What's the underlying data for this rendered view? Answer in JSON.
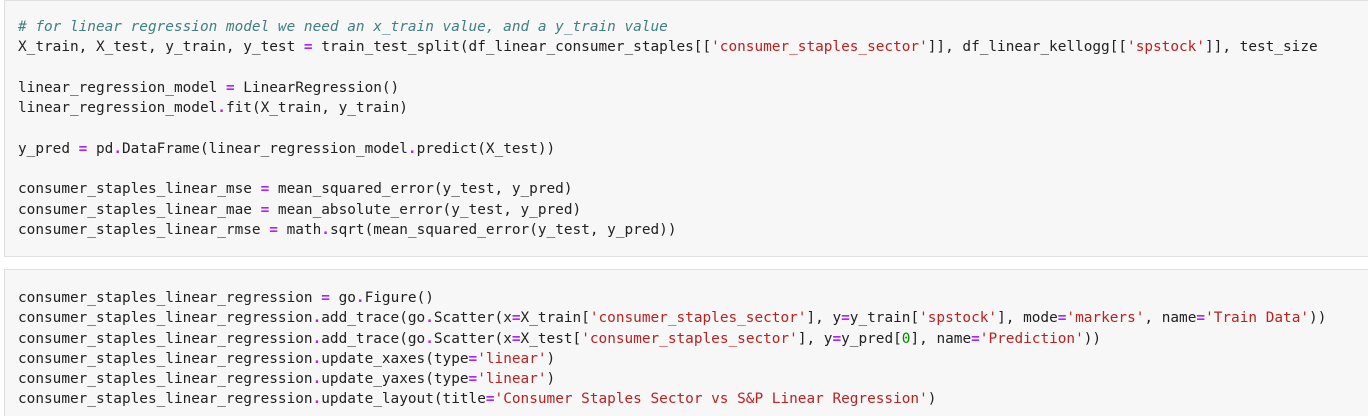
{
  "cells": [
    {
      "lines": [
        [
          {
            "t": "# for linear regression model we need an x_train value, and a y_train value",
            "k": "cm"
          }
        ],
        [
          {
            "t": "X_train, X_test, y_train, y_test ",
            "k": ""
          },
          {
            "t": "=",
            "k": "op"
          },
          {
            "t": " train_test_split(df_linear_consumer_staples[[",
            "k": ""
          },
          {
            "t": "'consumer_staples_sector'",
            "k": "st"
          },
          {
            "t": "]], df_linear_kellogg[[",
            "k": ""
          },
          {
            "t": "'spstock'",
            "k": "st"
          },
          {
            "t": "]], test_size",
            "k": ""
          }
        ],
        [],
        [
          {
            "t": "linear_regression_model ",
            "k": ""
          },
          {
            "t": "=",
            "k": "op"
          },
          {
            "t": " LinearRegression()",
            "k": ""
          }
        ],
        [
          {
            "t": "linear_regression_model",
            "k": ""
          },
          {
            "t": ".",
            "k": "op"
          },
          {
            "t": "fit(X_train, y_train)",
            "k": ""
          }
        ],
        [],
        [
          {
            "t": "y_pred ",
            "k": ""
          },
          {
            "t": "=",
            "k": "op"
          },
          {
            "t": " pd",
            "k": ""
          },
          {
            "t": ".",
            "k": "op"
          },
          {
            "t": "DataFrame(linear_regression_model",
            "k": ""
          },
          {
            "t": ".",
            "k": "op"
          },
          {
            "t": "predict(X_test))",
            "k": ""
          }
        ],
        [],
        [
          {
            "t": "consumer_staples_linear_mse ",
            "k": ""
          },
          {
            "t": "=",
            "k": "op"
          },
          {
            "t": " mean_squared_error(y_test, y_pred)",
            "k": ""
          }
        ],
        [
          {
            "t": "consumer_staples_linear_mae ",
            "k": ""
          },
          {
            "t": "=",
            "k": "op"
          },
          {
            "t": " mean_absolute_error(y_test, y_pred)",
            "k": ""
          }
        ],
        [
          {
            "t": "consumer_staples_linear_rmse ",
            "k": ""
          },
          {
            "t": "=",
            "k": "op"
          },
          {
            "t": " math",
            "k": ""
          },
          {
            "t": ".",
            "k": "op"
          },
          {
            "t": "sqrt(mean_squared_error(y_test, y_pred))",
            "k": ""
          }
        ]
      ]
    },
    {
      "lines": [
        [
          {
            "t": "consumer_staples_linear_regression ",
            "k": ""
          },
          {
            "t": "=",
            "k": "op"
          },
          {
            "t": " go",
            "k": ""
          },
          {
            "t": ".",
            "k": "op"
          },
          {
            "t": "Figure()",
            "k": ""
          }
        ],
        [
          {
            "t": "consumer_staples_linear_regression",
            "k": ""
          },
          {
            "t": ".",
            "k": "op"
          },
          {
            "t": "add_trace(go",
            "k": ""
          },
          {
            "t": ".",
            "k": "op"
          },
          {
            "t": "Scatter(x",
            "k": ""
          },
          {
            "t": "=",
            "k": "op"
          },
          {
            "t": "X_train[",
            "k": ""
          },
          {
            "t": "'consumer_staples_sector'",
            "k": "st"
          },
          {
            "t": "], y",
            "k": ""
          },
          {
            "t": "=",
            "k": "op"
          },
          {
            "t": "y_train[",
            "k": ""
          },
          {
            "t": "'spstock'",
            "k": "st"
          },
          {
            "t": "], mode",
            "k": ""
          },
          {
            "t": "=",
            "k": "op"
          },
          {
            "t": "'markers'",
            "k": "st"
          },
          {
            "t": ", name",
            "k": ""
          },
          {
            "t": "=",
            "k": "op"
          },
          {
            "t": "'Train Data'",
            "k": "st"
          },
          {
            "t": "))",
            "k": ""
          }
        ],
        [
          {
            "t": "consumer_staples_linear_regression",
            "k": ""
          },
          {
            "t": ".",
            "k": "op"
          },
          {
            "t": "add_trace(go",
            "k": ""
          },
          {
            "t": ".",
            "k": "op"
          },
          {
            "t": "Scatter(x",
            "k": ""
          },
          {
            "t": "=",
            "k": "op"
          },
          {
            "t": "X_test[",
            "k": ""
          },
          {
            "t": "'consumer_staples_sector'",
            "k": "st"
          },
          {
            "t": "], y",
            "k": ""
          },
          {
            "t": "=",
            "k": "op"
          },
          {
            "t": "y_pred[",
            "k": ""
          },
          {
            "t": "0",
            "k": "nm"
          },
          {
            "t": "], name",
            "k": ""
          },
          {
            "t": "=",
            "k": "op"
          },
          {
            "t": "'Prediction'",
            "k": "st"
          },
          {
            "t": "))",
            "k": ""
          }
        ],
        [
          {
            "t": "consumer_staples_linear_regression",
            "k": ""
          },
          {
            "t": ".",
            "k": "op"
          },
          {
            "t": "update_xaxes(type",
            "k": ""
          },
          {
            "t": "=",
            "k": "op"
          },
          {
            "t": "'linear'",
            "k": "st"
          },
          {
            "t": ")",
            "k": ""
          }
        ],
        [
          {
            "t": "consumer_staples_linear_regression",
            "k": ""
          },
          {
            "t": ".",
            "k": "op"
          },
          {
            "t": "update_yaxes(type",
            "k": ""
          },
          {
            "t": "=",
            "k": "op"
          },
          {
            "t": "'linear'",
            "k": "st"
          },
          {
            "t": ")",
            "k": ""
          }
        ],
        [
          {
            "t": "consumer_staples_linear_regression",
            "k": ""
          },
          {
            "t": ".",
            "k": "op"
          },
          {
            "t": "update_layout(title",
            "k": ""
          },
          {
            "t": "=",
            "k": "op"
          },
          {
            "t": "'Consumer Staples Sector vs S&P Linear Regression'",
            "k": "st"
          },
          {
            "t": ")",
            "k": ""
          }
        ]
      ]
    }
  ]
}
